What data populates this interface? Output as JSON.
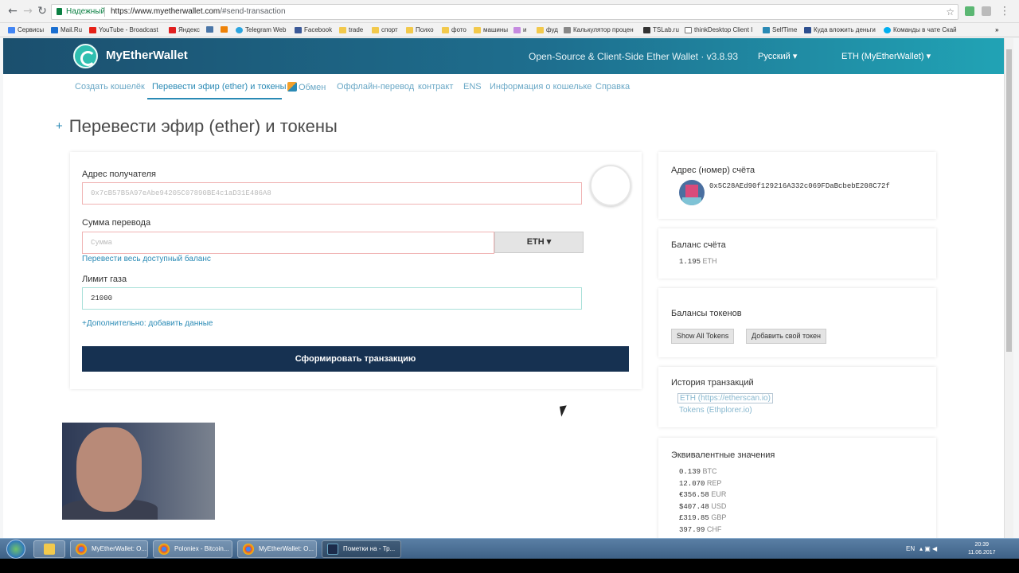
{
  "browser": {
    "secure_label": "Надежный",
    "url_host": "https://www.myetherwallet.com",
    "url_rest": "/#send-transaction",
    "bookmarks": [
      {
        "label": "Сервисы",
        "color": "#4285f4"
      },
      {
        "label": "Mail.Ru",
        "color": "#1a6fd1"
      },
      {
        "label": "YouTube - Broadcast",
        "color": "#e62117"
      },
      {
        "label": "Яндекс",
        "color": "#e02020"
      },
      {
        "label": "",
        "color": "#4a76a8"
      },
      {
        "label": "",
        "color": "#ee8208"
      },
      {
        "label": "Telegram Web",
        "color": "#2ca5e0"
      },
      {
        "label": "Facebook",
        "color": "#3b5998"
      },
      {
        "label": "trade",
        "color": "#f2c94c"
      },
      {
        "label": "спорт",
        "color": "#f2c94c"
      },
      {
        "label": "Психо",
        "color": "#f2c94c"
      },
      {
        "label": "фото",
        "color": "#f2c94c"
      },
      {
        "label": "машины",
        "color": "#f2c94c"
      },
      {
        "label": "и",
        "color": "#c58be0"
      },
      {
        "label": "фуд",
        "color": "#f2c94c"
      },
      {
        "label": "Калькулятор процен",
        "color": "#888888"
      },
      {
        "label": "TSLab.ru",
        "color": "#333333"
      },
      {
        "label": "thinkDesktop Client I",
        "color": "#777777"
      },
      {
        "label": "SelfTime",
        "color": "#2a8ab5"
      },
      {
        "label": "Куда вложить деньги",
        "color": "#2d4f8f"
      },
      {
        "label": "Команды в чате Скай",
        "color": "#00aff0"
      }
    ]
  },
  "header": {
    "logo": "MyEtherWallet",
    "tagline": "Open-Source & Client-Side Ether Wallet · v3.8.93",
    "language": "Русский",
    "network": "ETH (MyEtherWallet)"
  },
  "subnav": {
    "items": [
      "Создать кошелёк",
      "Перевести эфир (ether) и токены",
      "Обмен",
      "Оффлайн-перевод",
      "контракт",
      "ENS",
      "Информация о кошельке",
      "Справка"
    ]
  },
  "page_title": "Перевести эфир (ether) и токены",
  "form": {
    "recipient_label": "Адрес получателя",
    "recipient_placeholder": "0x7cB57B5A97eAbe94205C07890BE4c1aD31E486A8",
    "amount_label": "Сумма перевода",
    "amount_placeholder": "Сумма",
    "currency": "ETH",
    "send_all_link": "Перевести весь доступный баланс",
    "gas_label": "Лимит газа",
    "gas_value": "21000",
    "advanced_link": "+Дополнительно: добавить данные",
    "generate_button": "Сформировать транзакцию"
  },
  "sidebar": {
    "address_title": "Адрес (номер) счёта",
    "address": "0x5C28AEd90f129216A332c069FDaBcbebE208C72f",
    "balance_title": "Баланс счёта",
    "balance_value": "1.195",
    "balance_unit": "ETH",
    "tokens_title": "Балансы токенов",
    "show_tokens_button": "Show All Tokens",
    "add_token_button": "Добавить свой токен",
    "history_title": "История транзакций",
    "history_eth_link": "ETH (https://etherscan.io)",
    "history_tokens_link": "Tokens (Ethplorer.io)",
    "equiv_title": "Эквивалентные значения",
    "equiv": [
      {
        "value": "0.139",
        "unit": "BTC"
      },
      {
        "value": "12.070",
        "unit": "REP"
      },
      {
        "value": "€356.58",
        "unit": "EUR"
      },
      {
        "value": "$407.48",
        "unit": "USD"
      },
      {
        "value": "£319.85",
        "unit": "GBP"
      },
      {
        "value": "397.99",
        "unit": "CHF"
      }
    ]
  },
  "taskbar": {
    "windows": [
      {
        "label": "MyEtherWallet: O...",
        "color": "#dd4b39"
      },
      {
        "label": "Poloniex - Bitcoin...",
        "color": "#dd4b39"
      },
      {
        "label": "MyEtherWallet: O...",
        "color": "#dd4b39"
      },
      {
        "label": "Пометки на - Тр...",
        "color": "#1c2b4a"
      }
    ],
    "language": "EN",
    "time": "20:39",
    "date": "11.06.2017"
  }
}
